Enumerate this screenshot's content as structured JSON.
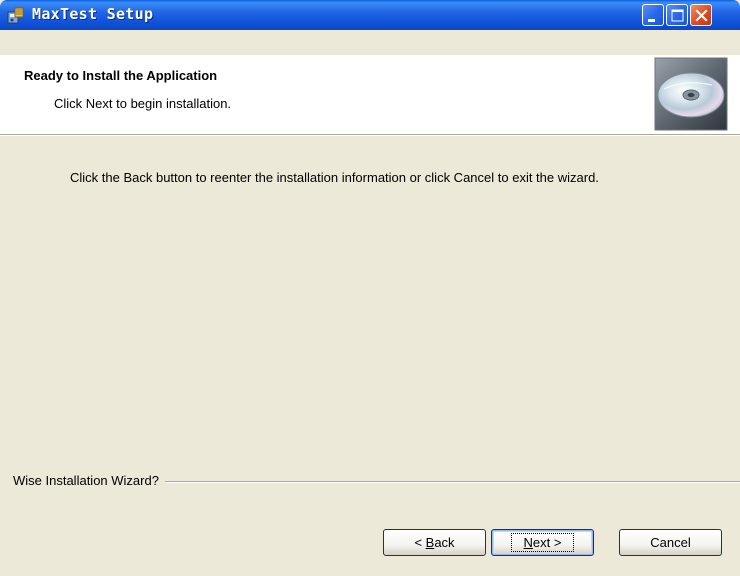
{
  "window": {
    "title": "MaxTest Setup",
    "icon": "setup-package-icon",
    "controls": [
      "minimize-icon",
      "maximize-icon",
      "close-icon"
    ]
  },
  "header": {
    "title": "Ready to Install the Application",
    "subtitle": "Click Next to begin installation.",
    "image": "install-cd-icon"
  },
  "body": {
    "text": "Click the Back button to reenter the installation information or click Cancel to exit the wizard."
  },
  "branding": {
    "text": "Wise Installation Wizard?"
  },
  "buttons": {
    "back": {
      "prefix": "< ",
      "mnemonic": "B",
      "rest": "ack"
    },
    "next": {
      "mnemonic": "N",
      "rest": "ext >"
    },
    "cancel": {
      "label": "Cancel"
    }
  },
  "colors": {
    "titlebar": "#0F52D9",
    "dialog_bg": "#ECE9D8",
    "close_button": "#DD4A22",
    "button_border": "#003C74"
  }
}
